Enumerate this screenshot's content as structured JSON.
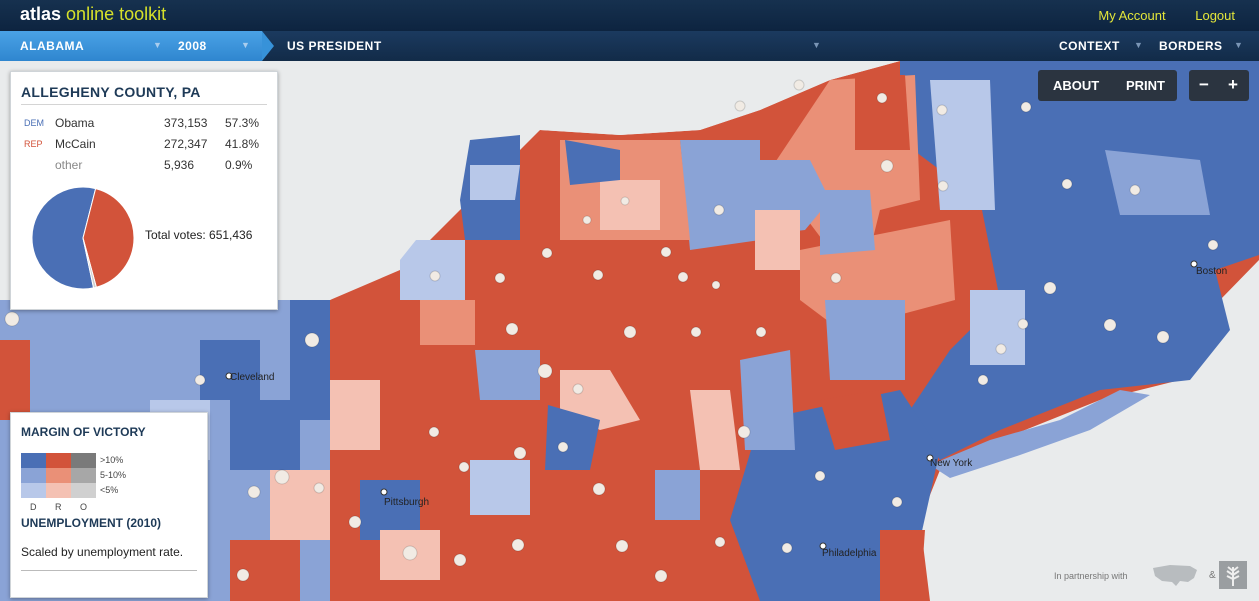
{
  "brand": {
    "bold": "atlas",
    "rest": "online toolkit"
  },
  "top_links": {
    "account": "My Account",
    "logout": "Logout"
  },
  "nav": {
    "state": "ALABAMA",
    "year": "2008",
    "race": "US PRESIDENT",
    "context": "CONTEXT",
    "borders": "BORDERS"
  },
  "controls": {
    "about": "ABOUT",
    "print": "PRINT",
    "zoom_out": "−",
    "zoom_in": "+"
  },
  "county": {
    "title": "ALLEGHENY COUNTY, PA",
    "rows": [
      {
        "party": "DEM",
        "candidate": "Obama",
        "votes": "373,153",
        "pct": "57.3%",
        "color": "#4a6fb5"
      },
      {
        "party": "REP",
        "candidate": "McCain",
        "votes": "272,347",
        "pct": "41.8%",
        "color": "#d2533a"
      },
      {
        "party": "",
        "candidate": "other",
        "votes": "5,936",
        "pct": "0.9%",
        "color": "#888888"
      }
    ],
    "shares": {
      "dem": 57.3,
      "rep": 41.8,
      "other": 0.9
    },
    "total": "Total votes: 651,436"
  },
  "legend": {
    "margin_title": "MARGIN OF VICTORY",
    "levels": [
      ">10%",
      "5-10%",
      "<5%"
    ],
    "columns": [
      "D",
      "R",
      "O"
    ],
    "colors": {
      "D": [
        "#4a6fb5",
        "#8aa3d6",
        "#b8c8e9"
      ],
      "R": [
        "#d2533a",
        "#ea9077",
        "#f4c1b3"
      ],
      "O": [
        "#7a7a7a",
        "#a7a7a7",
        "#d0d0d0"
      ]
    },
    "unemployment_title": "UNEMPLOYMENT (2010)",
    "unemployment_note": "Scaled by unemployment rate."
  },
  "cities": [
    "Cleveland",
    "Pittsburgh",
    "Philadelphia",
    "New York",
    "Boston"
  ],
  "partner": {
    "text": "In partnership with",
    "amp": "&"
  },
  "colors": {
    "water": "#e9ebec",
    "dem_strong": "#4a6fb5",
    "rep_strong": "#d2533a",
    "nav_selected": "#3792d9"
  }
}
